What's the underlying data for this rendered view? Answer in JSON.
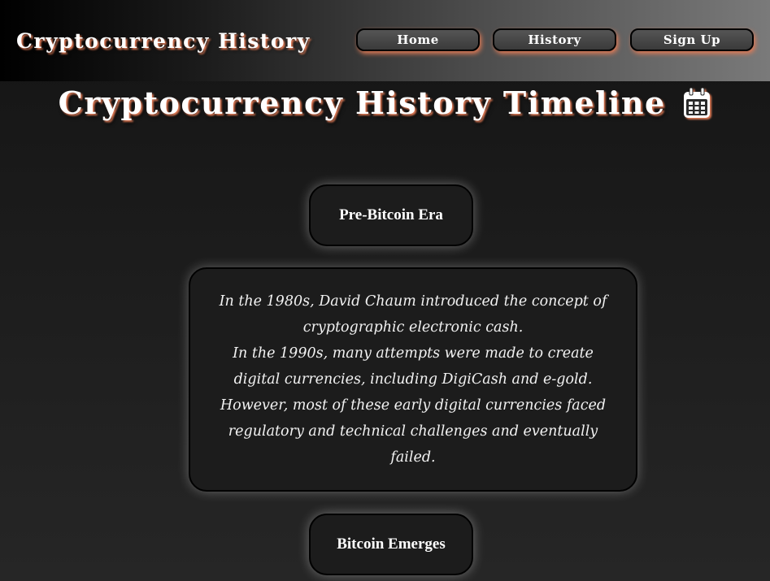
{
  "navbar": {
    "brand": "Cryptocurrency History",
    "links": [
      {
        "label": "Home"
      },
      {
        "label": "History"
      },
      {
        "label": "Sign Up"
      }
    ]
  },
  "main": {
    "title": "Cryptocurrency History Timeline",
    "title_icon": "calendar-icon",
    "eras": [
      {
        "label": "Pre-Bitcoin Era",
        "description": [
          "In the 1980s, David Chaum introduced the concept of cryptographic electronic cash.",
          "In the 1990s, many attempts were made to create digital currencies, including DigiCash and e-gold.",
          "However, most of these early digital currencies faced regulatory and technical challenges and eventually failed."
        ]
      },
      {
        "label": "Bitcoin Emerges"
      }
    ]
  },
  "colors": {
    "accent_shadow": "#e07a55",
    "background": "#1e1e1e",
    "text": "#ffffff"
  }
}
